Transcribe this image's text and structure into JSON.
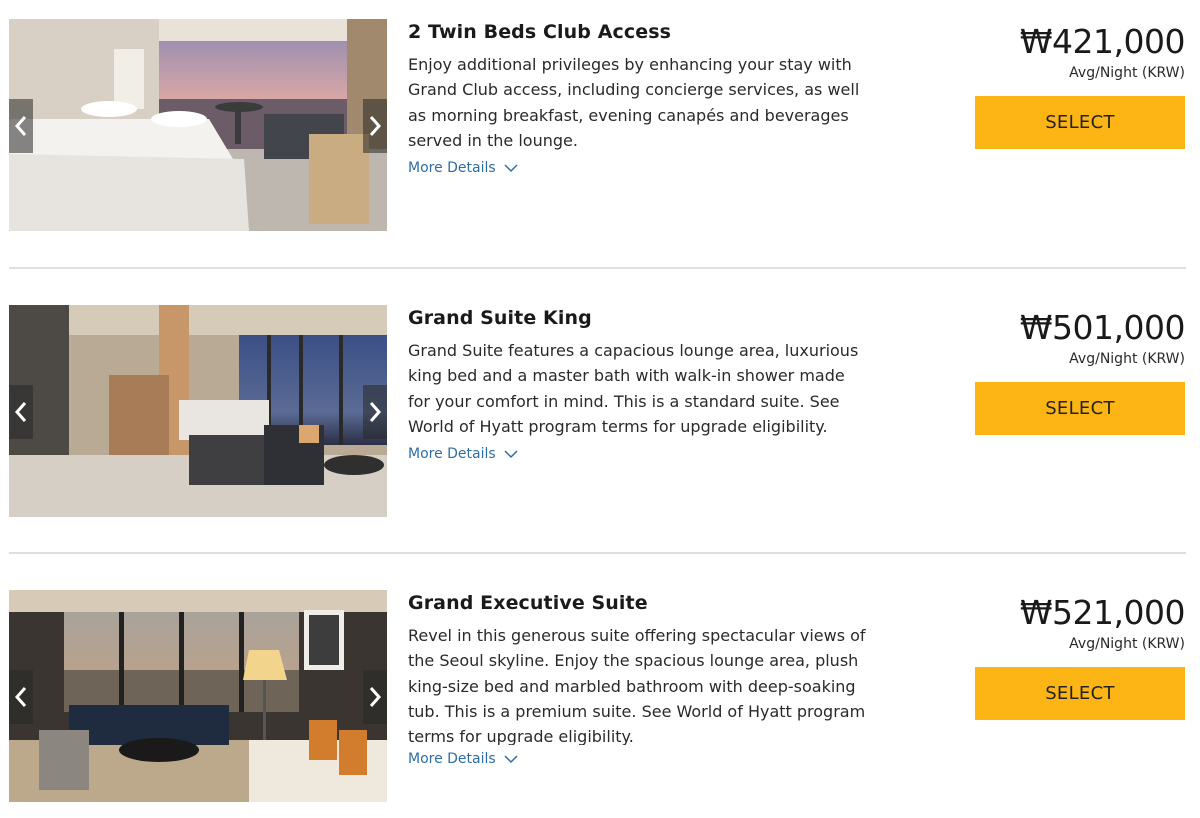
{
  "colors": {
    "accent": "#fdb515",
    "link": "#2e6ea6",
    "divider": "#dedede"
  },
  "rooms": [
    {
      "title": "2 Twin Beds Club Access",
      "description": "Enjoy additional privileges by enhancing your stay with Grand Club access, including concierge services, as well as morning breakfast, evening canapés and beverages served in the lounge.",
      "more_details_label": "More Details",
      "price": "₩421,000",
      "price_note": "Avg/Night (KRW)",
      "select_label": "SELECT"
    },
    {
      "title": "Grand Suite King",
      "description": "Grand Suite features a capacious lounge area, luxurious king bed and a master bath with walk-in shower made for your comfort in mind. This is a standard suite. See World of Hyatt program terms for upgrade eligibility.",
      "more_details_label": "More Details",
      "price": "₩501,000",
      "price_note": "Avg/Night (KRW)",
      "select_label": "SELECT"
    },
    {
      "title": "Grand Executive Suite",
      "description": "Revel in this generous suite offering spectacular views of the Seoul skyline. Enjoy the spacious lounge area, plush king-size bed and marbled bathroom with deep-soaking tub. This is a premium suite. See World of Hyatt program terms for upgrade eligibility.",
      "more_details_label": "More Details",
      "price": "₩521,000",
      "price_note": "Avg/Night (KRW)",
      "select_label": "SELECT"
    }
  ],
  "icons": {
    "prev": "chevron-left-icon",
    "next": "chevron-right-icon",
    "expand": "chevron-down-icon"
  }
}
